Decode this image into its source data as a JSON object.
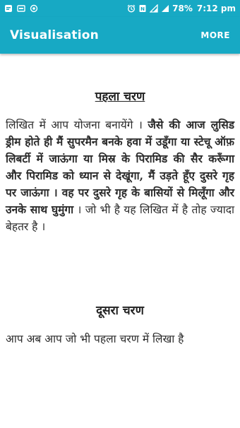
{
  "status_bar": {
    "icons_left": [
      "notification-icon",
      "message-icon",
      "circle-icon"
    ],
    "icons_right": [
      "alarm-icon",
      "nfc-icon",
      "signal-icon",
      "wifi-signal-icon"
    ],
    "battery": "78%",
    "time": "7:12 pm"
  },
  "app_bar": {
    "title": "Visualisation",
    "more_label": "MORE",
    "color": "#17a9c4"
  },
  "content": {
    "heading_1": "पहला चरण",
    "para_1_normal_a": "लिखित में आप योजना बनायेंगे । ",
    "para_1_bold": "जैसे की आज लुसिड ड्रीम होते ही मैं सुपरमैन बनके हवा में उडूँगा या स्टेचू ऑफ़ लिबर्टी में जाऊंगा या मिस्र के पिरामिड की सैर करूँगा और पिरामिड को ध्यान से देखूंगा, मैं उड़ते हूँए दुसरे गृह पर जाऊंगा । वह पर दुसरे गृह के बासियों से मिलूँगा और उनके साथ घुमुंगा",
    "para_1_normal_b": "। जो भी है यह लिखित में है तोह ज्यादा बेहतर है ।",
    "heading_2": "दूसरा चरण",
    "para_2": "आप अब आप जो भी पहला चरण में लिखा है"
  }
}
